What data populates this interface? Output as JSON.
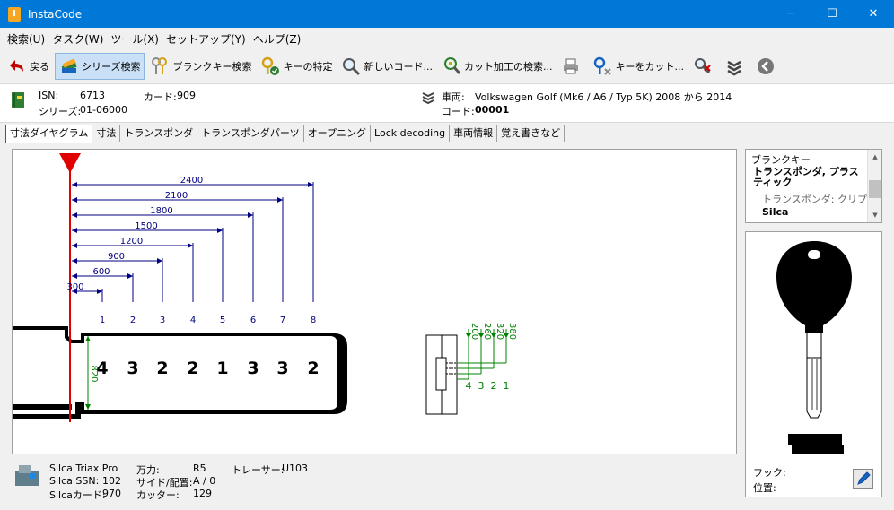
{
  "window": {
    "title": "InstaCode",
    "minimize": "─",
    "maximize": "☐",
    "close": "✕"
  },
  "menu": [
    "検索(U)",
    "タスク(W)",
    "ツール(X)",
    "セットアップ(Y)",
    "ヘルプ(Z)"
  ],
  "toolbar": {
    "back": "戻る",
    "series_search": "シリーズ検索",
    "blank_search": "ブランクキー検索",
    "key_identify": "キーの特定",
    "new_code": "新しいコード...",
    "cut_search": "カット加工の検索...",
    "key_cut": "キーをカット..."
  },
  "info": {
    "isn_label": "ISN:",
    "isn_value": "6713",
    "card_label": "カード:",
    "card_value": "909",
    "series_label": "シリーズ:",
    "series_value": "01-06000",
    "vehicle_label": "車両:",
    "vehicle_value": "Volkswagen Golf (Mk6 / A6 / Typ 5K) 2008 から 2014",
    "code_label": "コード:",
    "code_value": "00001"
  },
  "tabs": [
    "寸法ダイヤグラム",
    "寸法",
    "トランスポンダ",
    "トランスポンダパーツ",
    "オープニング",
    "Lock decoding",
    "車両情報",
    "覚え書きなど"
  ],
  "diagram": {
    "dimensions": [
      "2400",
      "2100",
      "1800",
      "1500",
      "1200",
      "900",
      "600",
      "300"
    ],
    "positions": [
      "1",
      "2",
      "3",
      "4",
      "5",
      "6",
      "7",
      "8"
    ],
    "cuts": [
      "4",
      "3",
      "2",
      "2",
      "1",
      "3",
      "3",
      "2"
    ],
    "width_label": "820",
    "depths": [
      "200",
      "260",
      "320",
      "380"
    ],
    "depth_numbers": [
      "4",
      "3",
      "2",
      "1"
    ]
  },
  "blank_key": {
    "header": "ブランクキー",
    "type": "トランスポンダ, プラスティック",
    "transponder": "トランスポンダ: クリプト",
    "brand": "Silca"
  },
  "key_panel": {
    "hook_label": "フック:",
    "position_label": "位置:"
  },
  "footer": {
    "machine": "Silca Triax Pro",
    "ssn_label": "Silca SSN:",
    "ssn_value": "102",
    "card_label": "Silcaカード:",
    "card_value": "970",
    "vise_label": "万力:",
    "vise_value": "R5",
    "side_label": "サイド/配置:",
    "side_value": "A / 0",
    "cutter_label": "カッター:",
    "cutter_value": "129",
    "tracer_label": "トレーサー:",
    "tracer_value": "U103"
  },
  "colors": {
    "titlebar": "#0078d7",
    "dim_line": "#000080",
    "depth_line": "#008000",
    "axis": "#e00000"
  }
}
